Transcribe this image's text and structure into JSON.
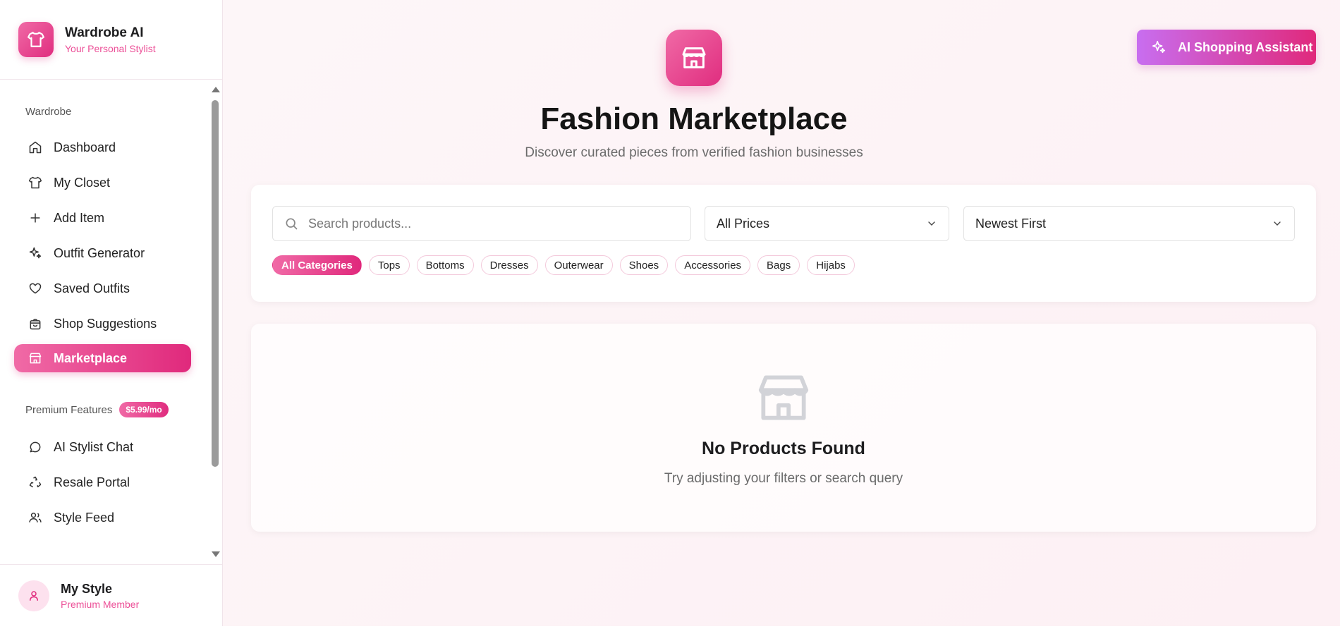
{
  "brand": {
    "name": "Wardrobe AI",
    "tagline": "Your Personal Stylist"
  },
  "sidebar": {
    "section_wardrobe": "Wardrobe",
    "items": [
      {
        "label": "Dashboard",
        "icon": "home-icon"
      },
      {
        "label": "My Closet",
        "icon": "shirt-icon"
      },
      {
        "label": "Add Item",
        "icon": "plus-icon"
      },
      {
        "label": "Outfit Generator",
        "icon": "sparkles-icon"
      },
      {
        "label": "Saved Outfits",
        "icon": "heart-icon"
      },
      {
        "label": "Shop Suggestions",
        "icon": "shopping-bag-icon"
      },
      {
        "label": "Marketplace",
        "icon": "store-icon",
        "active": true
      }
    ],
    "section_premium": "Premium Features",
    "premium_badge": "$5.99/mo",
    "premium_items": [
      {
        "label": "AI Stylist Chat",
        "icon": "chat-icon"
      },
      {
        "label": "Resale Portal",
        "icon": "recycle-icon"
      },
      {
        "label": "Style Feed",
        "icon": "users-icon"
      }
    ]
  },
  "profile": {
    "name": "My Style",
    "status": "Premium Member"
  },
  "header": {
    "title": "Fashion Marketplace",
    "subtitle": "Discover curated pieces from verified fashion businesses",
    "ai_button": "AI Shopping Assistant"
  },
  "filters": {
    "search_placeholder": "Search products...",
    "price_selected": "All Prices",
    "sort_selected": "Newest First",
    "categories": [
      "All Categories",
      "Tops",
      "Bottoms",
      "Dresses",
      "Outerwear",
      "Shoes",
      "Accessories",
      "Bags",
      "Hijabs"
    ]
  },
  "empty_state": {
    "title": "No Products Found",
    "message": "Try adjusting your filters or search query"
  },
  "colors": {
    "accent": "#e0297c",
    "accent_light": "#f06aa6",
    "purple": "#c86ef0"
  }
}
